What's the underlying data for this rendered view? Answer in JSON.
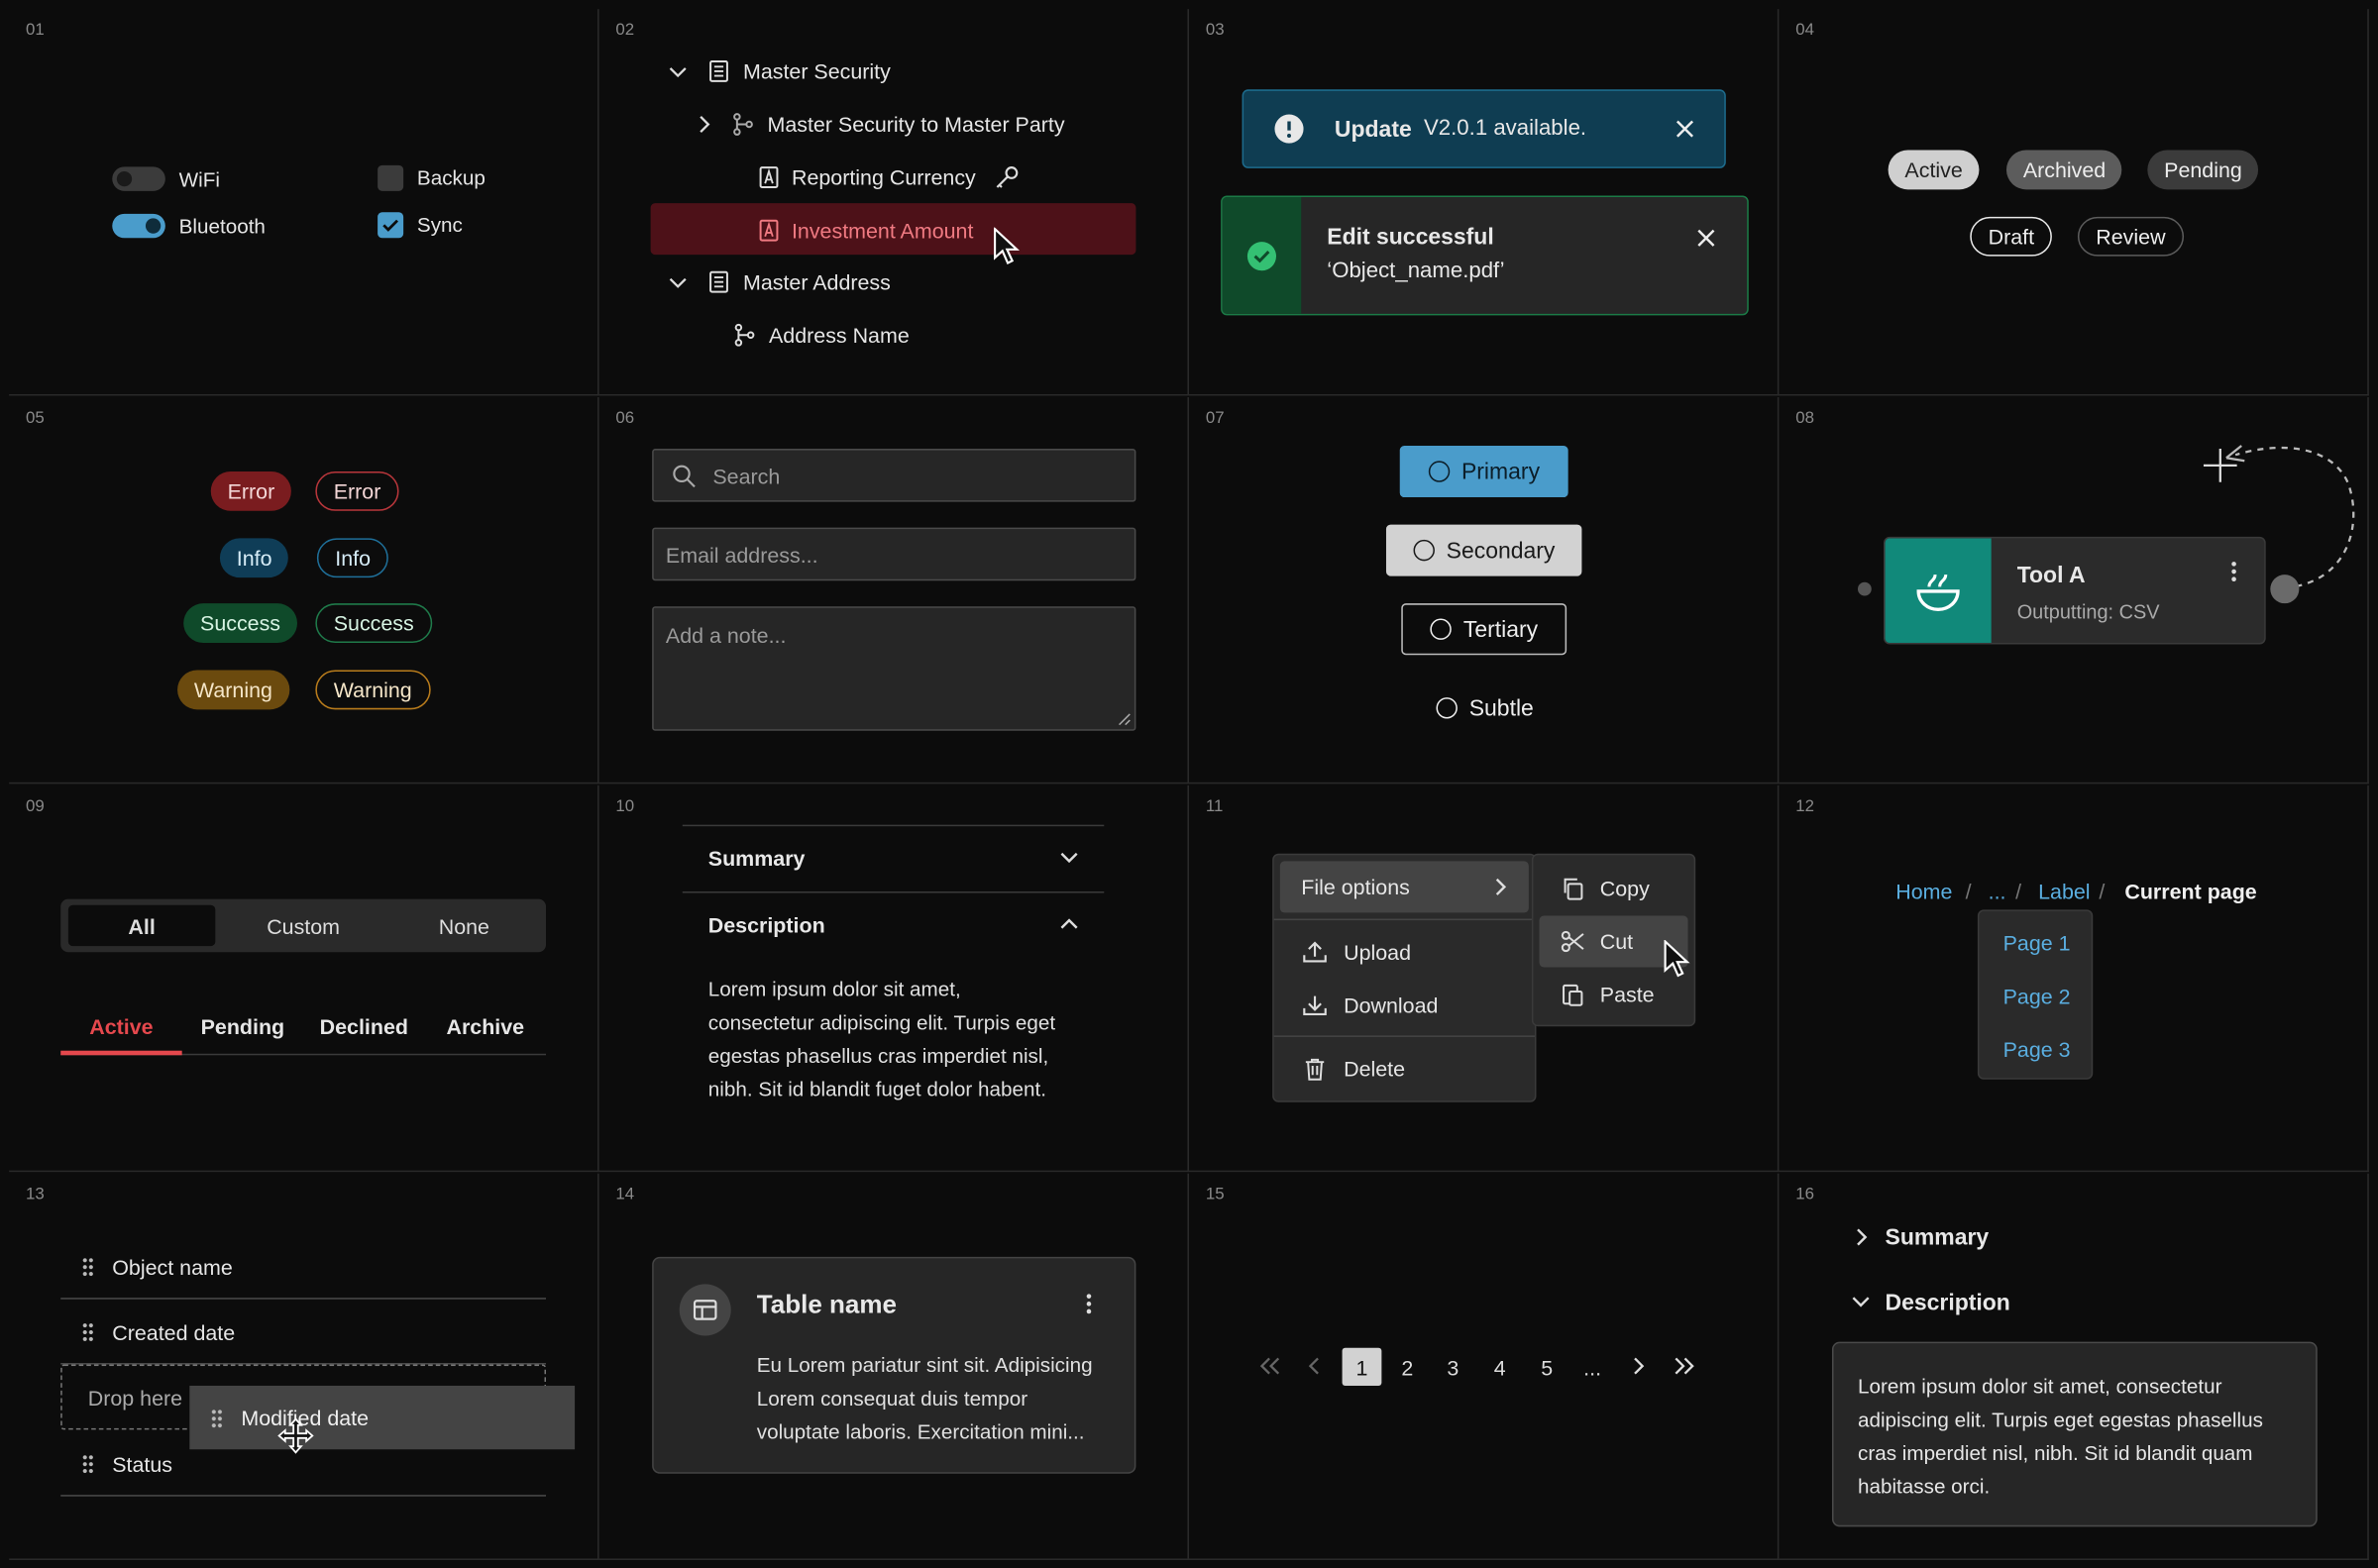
{
  "cell_numbers": [
    "01",
    "02",
    "03",
    "04",
    "05",
    "06",
    "07",
    "08",
    "09",
    "10",
    "11",
    "12",
    "13",
    "14",
    "15",
    "16"
  ],
  "toggles": [
    {
      "label": "WiFi",
      "on": false
    },
    {
      "label": "Bluetooth",
      "on": true
    }
  ],
  "checkboxes": [
    {
      "label": "Backup",
      "checked": false
    },
    {
      "label": "Sync",
      "checked": true
    }
  ],
  "tree": [
    {
      "label": "Master Security",
      "icon": "table-icon",
      "expanded": true
    },
    {
      "label": "Master Security to Master Party",
      "icon": "relationship-icon",
      "expanded": false
    },
    {
      "label": "Reporting Currency",
      "icon": "attribute-icon",
      "trailing_icon": "key-icon"
    },
    {
      "label": "Investment Amount",
      "icon": "attribute-icon",
      "selected": true
    },
    {
      "label": "Master Address",
      "icon": "table-icon",
      "expanded": true
    },
    {
      "label": "Address Name",
      "icon": "relationship-icon"
    }
  ],
  "toasts": {
    "update": {
      "title": "Update",
      "message": "V2.0.1 available."
    },
    "success": {
      "title": "Edit successful",
      "message": "‘Object_name.pdf’"
    }
  },
  "status_pills": [
    "Active",
    "Archived",
    "Pending",
    "Draft",
    "Review"
  ],
  "badges": [
    {
      "label": "Error",
      "color": "#e5484d"
    },
    {
      "label": "Info",
      "color": "#3b9fd4"
    },
    {
      "label": "Success",
      "color": "#2fae67"
    },
    {
      "label": "Warning",
      "color": "#e3a12f"
    }
  ],
  "inputs": {
    "search_placeholder": "Search",
    "email_placeholder": "Email address...",
    "note_placeholder": "Add a note..."
  },
  "buttons": [
    "Primary",
    "Secondary",
    "Tertiary",
    "Subtle"
  ],
  "node": {
    "title": "Tool A",
    "subtitle": "Outputting: CSV",
    "accent": "#11897a"
  },
  "segmented": {
    "items": [
      "All",
      "Custom",
      "None"
    ],
    "selected": "All"
  },
  "tabs": {
    "items": [
      "Active",
      "Pending",
      "Declined",
      "Archive"
    ],
    "selected": "Active",
    "accent": "#e5484d"
  },
  "accordion": {
    "summary": "Summary",
    "description": "Description",
    "body_lines": [
      "Lorem ipsum dolor sit amet,",
      "consectetur adipiscing elit. Turpis eget",
      "egestas phasellus cras imperdiet nisl,",
      "nibh. Sit id blandit fuget dolor habent."
    ]
  },
  "context_menu": {
    "file_options": "File options",
    "items": [
      "Upload",
      "Download",
      "Delete"
    ],
    "submenu": [
      "Copy",
      "Cut",
      "Paste"
    ]
  },
  "breadcrumb": {
    "items": [
      "Home",
      "...",
      "Label"
    ],
    "current": "Current page",
    "dropdown": [
      "Page 1",
      "Page 2",
      "Page 3"
    ]
  },
  "drag_list": {
    "items": [
      "Object name",
      "Created date",
      "Status"
    ],
    "drop_label": "Drop here",
    "dragging": "Modified date"
  },
  "card": {
    "title": "Table name",
    "body_lines": [
      "Eu Lorem pariatur sint sit. Adipisicing",
      "Lorem consequat duis tempor",
      "voluptate laboris. Exercitation mini..."
    ]
  },
  "pagination": {
    "pages": [
      "1",
      "2",
      "3",
      "4",
      "5",
      "..."
    ],
    "current": "1"
  },
  "panel16": {
    "summary": "Summary",
    "description": "Description",
    "body_lines": [
      "Lorem ipsum dolor sit amet, consectetur",
      "adipiscing elit. Turpis eget egestas phasellus",
      "cras imperdiet nisl, nibh. Sit id blandit quam",
      "habitasse orci."
    ]
  }
}
